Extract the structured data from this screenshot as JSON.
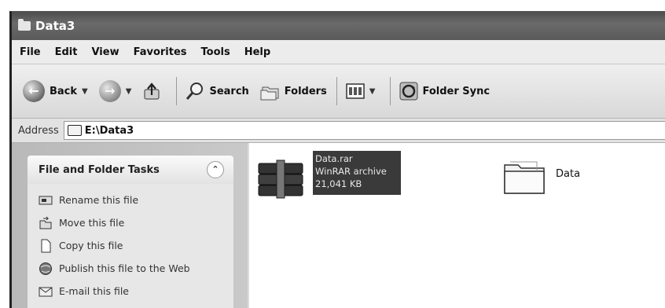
{
  "window": {
    "title": "Data3"
  },
  "menu": [
    "File",
    "Edit",
    "View",
    "Favorites",
    "Tools",
    "Help"
  ],
  "toolbar": {
    "back": "Back",
    "search": "Search",
    "folders": "Folders",
    "folder_sync": "Folder Sync"
  },
  "address": {
    "label": "Address",
    "value": "E:\\Data3"
  },
  "tasks": {
    "title": "File and Folder Tasks",
    "items": [
      {
        "label": "Rename this file",
        "icon": "rename-icon"
      },
      {
        "label": "Move this file",
        "icon": "move-icon"
      },
      {
        "label": "Copy this file",
        "icon": "copy-icon"
      },
      {
        "label": "Publish this file to the Web",
        "icon": "publish-web-icon"
      },
      {
        "label": "E-mail this file",
        "icon": "email-icon"
      }
    ]
  },
  "files": [
    {
      "name": "Data.rar",
      "type": "WinRAR archive",
      "size": "21,041 KB",
      "selected": true,
      "icon": "winrar-archive-icon"
    },
    {
      "name": "Data",
      "type": "folder",
      "icon": "folder-icon"
    }
  ]
}
